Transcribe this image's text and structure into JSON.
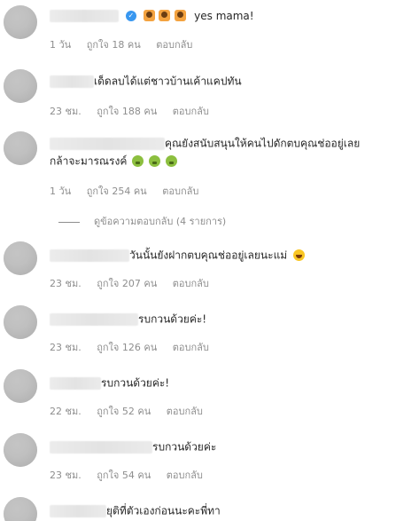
{
  "comments": [
    {
      "text": "yes mama!",
      "time": "1 วัน",
      "likes": "ถูกใจ 18 คน",
      "reply": "ตอบกลับ",
      "verified": true,
      "emojis": [
        "praise-hands-icon",
        "praise-hands-icon",
        "praise-hands-icon"
      ]
    },
    {
      "text": "เด็ดลบได้แต่ชาวบ้านเค้าแคปทัน",
      "time": "23 ชม.",
      "likes": "ถูกใจ 188 คน",
      "reply": "ตอบกลับ"
    },
    {
      "text_line1": "คุณยังสนับสนุนให้คนไปดักตบคุณช่ออยู่เลย",
      "text_line2": "กล้าจะมารณรงค์",
      "time": "1 วัน",
      "likes": "ถูกใจ 254 คน",
      "reply": "ตอบกลับ",
      "emojis": [
        "nauseated-face-icon",
        "nauseated-face-icon",
        "nauseated-face-icon"
      ],
      "view_replies": "ดูข้อความตอบกลับ (4 รายการ)"
    },
    {
      "text": "วันนั้นยังฝากตบคุณช่ออยู่เลยนะแม่",
      "time": "23 ชม.",
      "likes": "ถูกใจ 207 คน",
      "reply": "ตอบกลับ",
      "emojis": [
        "rolling-laughing-face-icon"
      ]
    },
    {
      "text": "รบกวนด้วยค่ะ!",
      "time": "23 ชม.",
      "likes": "ถูกใจ 126 คน",
      "reply": "ตอบกลับ"
    },
    {
      "text": "รบกวนด้วยค่ะ!",
      "time": "22 ชม.",
      "likes": "ถูกใจ 52 คน",
      "reply": "ตอบกลับ"
    },
    {
      "text": "รบกวนด้วยค่ะ",
      "time": "23 ชม.",
      "likes": "ถูกใจ 54 คน",
      "reply": "ตอบกลับ"
    },
    {
      "text": "ยุติที่ตัวเองก่อนนะคะพี่ทา"
    }
  ],
  "colors": {
    "text": "#262626",
    "meta": "#8e8e8e",
    "verified": "#3897f0"
  }
}
